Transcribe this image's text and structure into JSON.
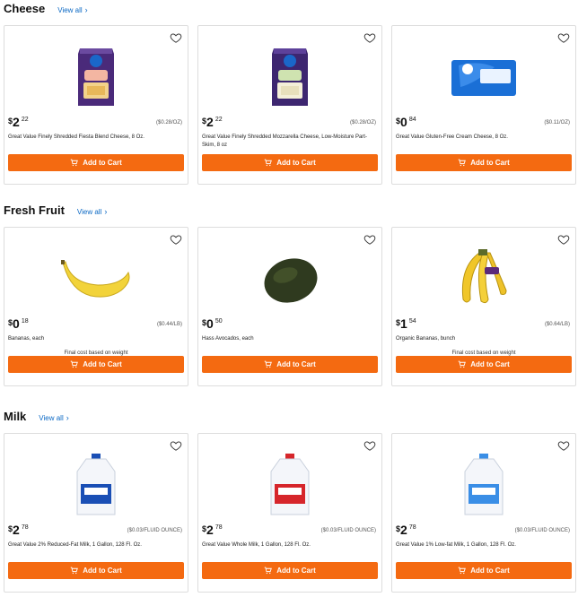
{
  "sections": [
    {
      "title": "Cheese",
      "view_all": "View all",
      "products": [
        {
          "dollar": "$",
          "whole": "2",
          "cents": "22",
          "unit_price": "($0.28/OZ)",
          "name": "Great Value Finely Shredded Fiesta Blend Cheese, 8 Oz.",
          "note": "",
          "cart_label": "Add to Cart",
          "image": "fiesta-cheese-bag"
        },
        {
          "dollar": "$",
          "whole": "2",
          "cents": "22",
          "unit_price": "($0.28/OZ)",
          "name": "Great Value Finely Shredded Mozzarella Cheese, Low-Moisture Part-Skim, 8 oz",
          "note": "",
          "cart_label": "Add to Cart",
          "image": "mozzarella-cheese-bag"
        },
        {
          "dollar": "$",
          "whole": "0",
          "cents": "84",
          "unit_price": "($0.11/OZ)",
          "name": "Great Value Gluten-Free Cream Cheese, 8 Oz.",
          "note": "",
          "cart_label": "Add to Cart",
          "image": "cream-cheese-box"
        }
      ]
    },
    {
      "title": "Fresh Fruit",
      "view_all": "View all",
      "products": [
        {
          "dollar": "$",
          "whole": "0",
          "cents": "18",
          "unit_price": "($0.44/LB)",
          "name": "Bananas, each",
          "note": "Final cost based on weight",
          "cart_label": "Add to Cart",
          "image": "banana"
        },
        {
          "dollar": "$",
          "whole": "0",
          "cents": "50",
          "unit_price": "",
          "name": "Hass Avocados, each",
          "note": "",
          "cart_label": "Add to Cart",
          "image": "avocado"
        },
        {
          "dollar": "$",
          "whole": "1",
          "cents": "54",
          "unit_price": "($0.64/LB)",
          "name": "Organic Bananas, bunch",
          "note": "Final cost based on weight",
          "cart_label": "Add to Cart",
          "image": "banana-bunch"
        }
      ]
    },
    {
      "title": "Milk",
      "view_all": "View all",
      "products": [
        {
          "dollar": "$",
          "whole": "2",
          "cents": "78",
          "unit_price": "($0.03/FLUID OUNCE)",
          "name": "Great Value 2% Reduced-Fat Milk, 1 Gallon, 128 Fl. Oz.",
          "note": "",
          "cart_label": "Add to Cart",
          "image": "milk-jug-blue"
        },
        {
          "dollar": "$",
          "whole": "2",
          "cents": "78",
          "unit_price": "($0.03/FLUID OUNCE)",
          "name": "Great Value Whole Milk, 1 Gallon, 128 Fl. Oz.",
          "note": "",
          "cart_label": "Add to Cart",
          "image": "milk-jug-red"
        },
        {
          "dollar": "$",
          "whole": "2",
          "cents": "78",
          "unit_price": "($0.03/FLUID OUNCE)",
          "name": "Great Value 1% Low-fat Milk, 1 Gallon, 128 Fl. Oz.",
          "note": "",
          "cart_label": "Add to Cart",
          "image": "milk-jug-light-blue"
        }
      ]
    }
  ],
  "icons": {
    "heart": "heart-icon",
    "cart": "cart-icon",
    "chevron": "chevron-right-icon"
  },
  "colors": {
    "accent": "#f46a11",
    "link": "#0a68c4",
    "border": "#dddddd"
  }
}
